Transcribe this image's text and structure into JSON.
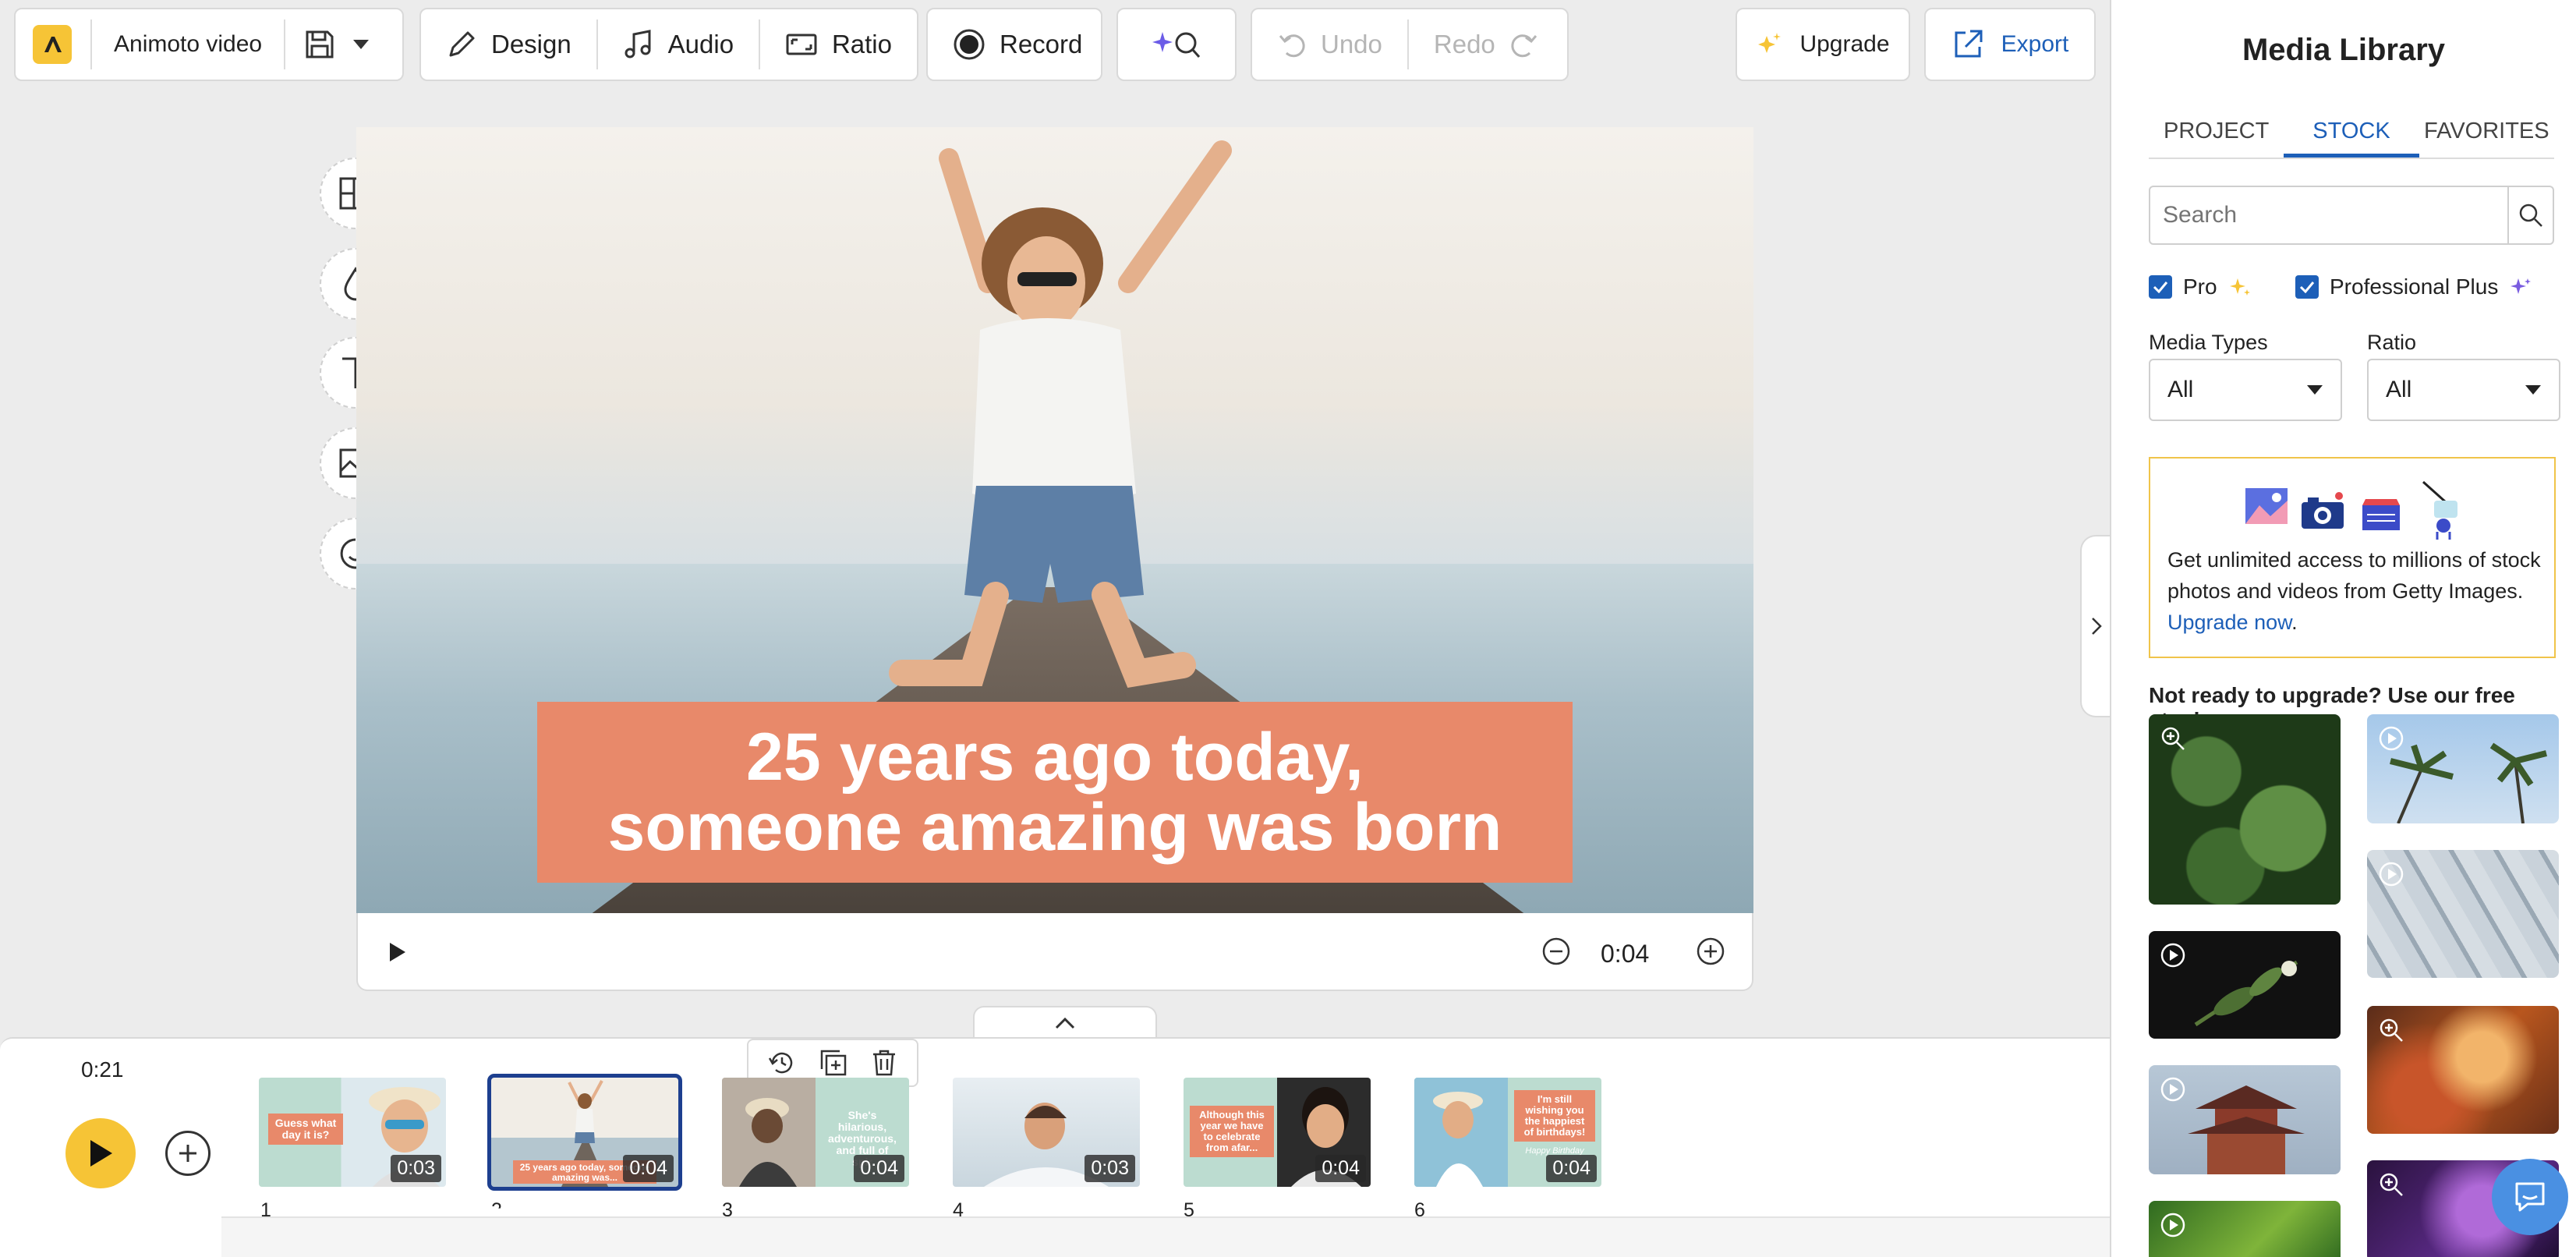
{
  "toolbar": {
    "project_name": "Animoto video",
    "design_label": "Design",
    "audio_label": "Audio",
    "ratio_label": "Ratio",
    "record_label": "Record",
    "undo_label": "Undo",
    "redo_label": "Redo",
    "upgrade_label": "Upgrade",
    "export_label": "Export"
  },
  "stage": {
    "title_line1": "25 years ago today,",
    "title_line2": "someone amazing was born",
    "duration": "0:04"
  },
  "timeline": {
    "total_time": "0:21",
    "clips": [
      {
        "number": "1",
        "duration": "0:03",
        "caption": "Guess what day it is?"
      },
      {
        "number": "2",
        "duration": "0:04",
        "caption": "25 years ago today, someone amazing was..."
      },
      {
        "number": "3",
        "duration": "0:04",
        "caption": "She's hilarious, adventurous, and full of spir"
      },
      {
        "number": "4",
        "duration": "0:03",
        "caption": ""
      },
      {
        "number": "5",
        "duration": "0:04",
        "caption": "Although this year we have to celebrate from afar..."
      },
      {
        "number": "6",
        "duration": "0:04",
        "caption": "I'm still wishing you the happiest of birthdays!"
      }
    ],
    "clip6_subcaption": "Happy Birthday"
  },
  "panel": {
    "title": "Media Library",
    "tabs": [
      "PROJECT",
      "STOCK",
      "FAVORITES"
    ],
    "active_tab": "STOCK",
    "search_placeholder": "Search",
    "pro_label": "Pro",
    "pro_plus_label": "Professional Plus",
    "media_types_label": "Media Types",
    "media_types_value": "All",
    "ratio_label": "Ratio",
    "ratio_value": "All",
    "promo_text": "Get unlimited access to millions of stock photos and videos from Getty Images.",
    "promo_link": "Upgrade now",
    "free_stock_title": "Not ready to upgrade? Use our free stock:"
  },
  "colors": {
    "accent_yellow": "#f6c436",
    "accent_blue": "#1d5fb8",
    "caption_orange": "#e8896a"
  }
}
